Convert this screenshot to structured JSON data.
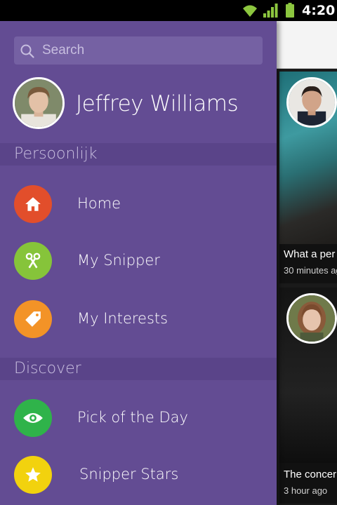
{
  "status_bar": {
    "time": "4:20",
    "icons": [
      "wifi-icon",
      "signal-icon",
      "battery-icon"
    ]
  },
  "drawer": {
    "search": {
      "placeholder": "Search"
    },
    "profile": {
      "name": "Jeffrey Williams"
    },
    "sections": [
      {
        "title": "Persoonlijk",
        "items": [
          {
            "label": "Home",
            "icon": "home-icon",
            "color": "#e24e2b"
          },
          {
            "label": "My Snipper",
            "icon": "scissors-icon",
            "color": "#86c43a"
          },
          {
            "label": "My Interests",
            "icon": "tag-icon",
            "color": "#f39327"
          }
        ]
      },
      {
        "title": "Discover",
        "items": [
          {
            "label": "Pick of the Day",
            "icon": "eye-icon",
            "color": "#2fb34a"
          },
          {
            "label": "Snipper Stars",
            "icon": "star-icon",
            "color": "#f2d20e"
          }
        ]
      }
    ]
  },
  "feed": {
    "cards": [
      {
        "title": "What a per",
        "time": "30 minutes ag"
      },
      {
        "title": "The concer",
        "time": "3 hour ago"
      }
    ]
  },
  "colors": {
    "drawer_bg": "#634c93",
    "section_bg": "#5a4489",
    "search_bg": "#7561a3"
  }
}
